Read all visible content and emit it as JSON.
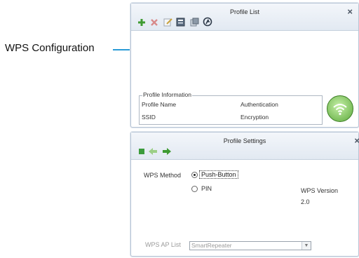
{
  "callout": {
    "label": "WPS Configuration"
  },
  "profile_list": {
    "title": "Profile List",
    "close_glyph": "×",
    "toolbar": [
      {
        "icon": "add-icon",
        "color": "#3f9b32"
      },
      {
        "icon": "delete-icon",
        "color": "#d05050"
      },
      {
        "icon": "edit-icon",
        "color": "#8c8f94"
      },
      {
        "icon": "duplicate-icon",
        "color": "#3b4a5c"
      },
      {
        "icon": "set-default-icon",
        "color": "#5b6775"
      },
      {
        "icon": "wps-icon",
        "color": "#2f3b4a"
      }
    ],
    "info": {
      "legend": "Profile Information",
      "profile_name_label": "Profile Name",
      "ssid_label": "SSID",
      "authentication_label": "Authentication",
      "encryption_label": "Encryption"
    },
    "connect_icon": "wifi-connect-icon"
  },
  "profile_settings": {
    "title": "Profile Settings",
    "close_glyph": "×",
    "toolbar": [
      {
        "icon": "stop-icon",
        "color": "#3b9b3b"
      },
      {
        "icon": "back-icon",
        "color": "#9ccf86"
      },
      {
        "icon": "forward-icon",
        "color": "#3f9b32"
      }
    ],
    "wps_method_label": "WPS Method",
    "options": [
      {
        "label": "Push-Button",
        "selected": true
      },
      {
        "label": "PIN",
        "selected": false
      }
    ],
    "wps_version_label": "WPS Version",
    "wps_version_value": "2.0",
    "ap_list_label": "WPS AP List",
    "ap_list_value": "SmartRepeater"
  }
}
